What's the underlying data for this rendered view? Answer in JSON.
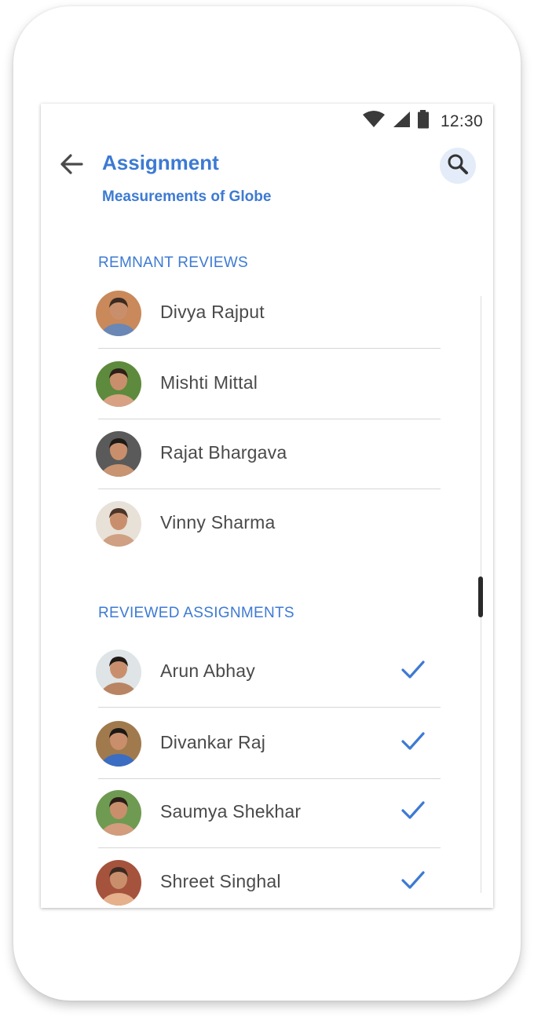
{
  "status_bar": {
    "time": "12:30",
    "icons": [
      "wifi-icon",
      "signal-icon",
      "battery-icon"
    ]
  },
  "header": {
    "title": "Assignment",
    "subtitle": "Measurements of Globe",
    "back_icon": "arrow-left-icon",
    "search_icon": "search-icon"
  },
  "sections": [
    {
      "header": "REMNANT REVIEWS",
      "items": [
        {
          "name": "Divya Rajput",
          "reviewed": false,
          "avatar_colors": [
            "#c9895a",
            "#3b2a22",
            "#6a87b5"
          ]
        },
        {
          "name": "Mishti Mittal",
          "reviewed": false,
          "avatar_colors": [
            "#5d8a3c",
            "#2d1f19",
            "#d9a184"
          ]
        },
        {
          "name": "Rajat Bhargava",
          "reviewed": false,
          "avatar_colors": [
            "#5a5a5a",
            "#1e1a18",
            "#c99472"
          ]
        },
        {
          "name": "Vinny Sharma",
          "reviewed": false,
          "avatar_colors": [
            "#e8e1d8",
            "#4a3528",
            "#cfa083"
          ]
        }
      ]
    },
    {
      "header": "REVIEWED ASSIGNMENTS",
      "items": [
        {
          "name": "Arun Abhay",
          "reviewed": true,
          "avatar_colors": [
            "#dfe4e6",
            "#1f1a17",
            "#b98463"
          ]
        },
        {
          "name": "Divankar Raj",
          "reviewed": true,
          "avatar_colors": [
            "#a07a4d",
            "#1c1816",
            "#3b6dc2"
          ]
        },
        {
          "name": "Saumya Shekhar",
          "reviewed": true,
          "avatar_colors": [
            "#6f9a52",
            "#2a1d17",
            "#d39c7c"
          ]
        },
        {
          "name": "Shreet Singhal",
          "reviewed": true,
          "avatar_colors": [
            "#a5533d",
            "#3a2a21",
            "#e6b08c"
          ]
        }
      ]
    }
  ],
  "colors": {
    "accent": "#3d7ad3",
    "text": "#4a4a4a",
    "divider": "#d6d6d6",
    "search_bg": "#e3ecf8"
  }
}
